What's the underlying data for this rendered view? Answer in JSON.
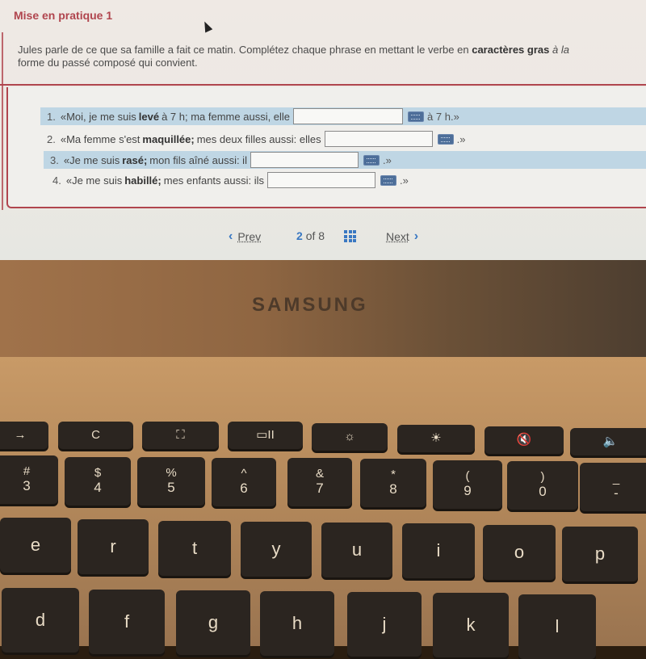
{
  "screen": {
    "title": "Mise en pratique 1",
    "instructions": {
      "part1": "Jules parle de ce que sa famille a fait ce matin. Complétez chaque phrase en mettant le verbe en ",
      "bold": "caractères gras",
      "part2": " à la",
      "part3": "forme du passé composé qui convient."
    },
    "items": [
      {
        "num": "1.",
        "before": "«Moi, je me suis",
        "bold": "levé",
        "after": "à 7 h; ma femme aussi, elle",
        "answer": "",
        "tail": "à 7 h.»"
      },
      {
        "num": "2.",
        "before": "«Ma femme s'est",
        "bold": "maquillée;",
        "after": "mes deux filles aussi: elles",
        "answer": "",
        "tail": ".»"
      },
      {
        "num": "3.",
        "before": "«Je me suis",
        "bold": "rasé;",
        "after": "mon fils aîné aussi: il",
        "answer": "",
        "tail": ".»"
      },
      {
        "num": "4.",
        "before": "«Je me suis",
        "bold": "habillé;",
        "after": "mes enfants aussi: ils",
        "answer": "",
        "tail": ".»"
      }
    ],
    "keyboard_icon": "keyboard-icon",
    "pager": {
      "prev": "Prev",
      "current": "2",
      "of": "of",
      "total": "8",
      "next": "Next"
    }
  },
  "laptop": {
    "brand": "SAMSUNG",
    "keys": {
      "fn_row": [
        {
          "name": "forward-key",
          "label": "→"
        },
        {
          "name": "refresh-key",
          "label": "C"
        },
        {
          "name": "fullscreen-key",
          "label": "⛶"
        },
        {
          "name": "overview-key",
          "label": "▭II"
        },
        {
          "name": "brightness-down-key",
          "label": "☼"
        },
        {
          "name": "brightness-up-key",
          "label": "☀"
        },
        {
          "name": "mute-key",
          "label": "🔇"
        },
        {
          "name": "volume-key",
          "label": "🔈"
        }
      ],
      "number_row": [
        {
          "sym": "#",
          "main": "3"
        },
        {
          "sym": "$",
          "main": "4"
        },
        {
          "sym": "%",
          "main": "5"
        },
        {
          "sym": "^",
          "main": "6"
        },
        {
          "sym": "&",
          "main": "7"
        },
        {
          "sym": "*",
          "main": "8"
        },
        {
          "sym": "(",
          "main": "9"
        },
        {
          "sym": ")",
          "main": "0"
        },
        {
          "sym": "_",
          "main": "-"
        }
      ],
      "top_row": [
        "e",
        "r",
        "t",
        "y",
        "u",
        "i",
        "o",
        "p"
      ],
      "home_row": [
        "d",
        "f",
        "g",
        "h",
        "j",
        "k",
        "l"
      ]
    }
  }
}
